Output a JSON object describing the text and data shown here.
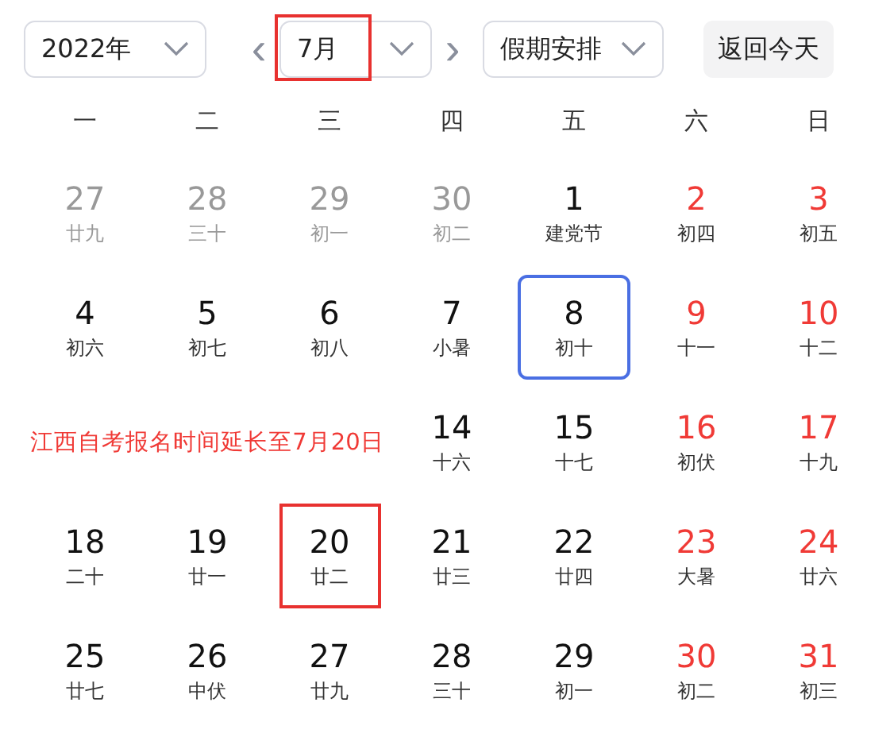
{
  "toolbar": {
    "year": "2022年",
    "month": {
      "value": "7月",
      "highlighted": true
    },
    "holiday": "假期安排",
    "today_button": "返回今天",
    "prev": "‹",
    "next": "›"
  },
  "weekdays": [
    "一",
    "二",
    "三",
    "四",
    "五",
    "六",
    "日"
  ],
  "days": [
    {
      "kind": "other",
      "day": "27",
      "lunar": "廿九"
    },
    {
      "kind": "other",
      "day": "28",
      "lunar": "三十"
    },
    {
      "kind": "other",
      "day": "29",
      "lunar": "初一"
    },
    {
      "kind": "other",
      "day": "30",
      "lunar": "初二"
    },
    {
      "kind": "day",
      "day": "1",
      "lunar": "建党节",
      "red": false,
      "selected": false,
      "highlighted": false
    },
    {
      "kind": "day",
      "day": "2",
      "lunar": "初四",
      "red": true,
      "selected": false,
      "highlighted": false
    },
    {
      "kind": "day",
      "day": "3",
      "lunar": "初五",
      "red": true,
      "selected": false,
      "highlighted": false
    },
    {
      "kind": "day",
      "day": "4",
      "lunar": "初六",
      "red": false,
      "selected": false,
      "highlighted": false
    },
    {
      "kind": "day",
      "day": "5",
      "lunar": "初七",
      "red": false,
      "selected": false,
      "highlighted": false
    },
    {
      "kind": "day",
      "day": "6",
      "lunar": "初八",
      "red": false,
      "selected": false,
      "highlighted": false
    },
    {
      "kind": "day",
      "day": "7",
      "lunar": "小暑",
      "red": false,
      "selected": false,
      "highlighted": false
    },
    {
      "kind": "day",
      "day": "8",
      "lunar": "初十",
      "red": false,
      "selected": true,
      "highlighted": false
    },
    {
      "kind": "day",
      "day": "9",
      "lunar": "十一",
      "red": true,
      "selected": false,
      "highlighted": false
    },
    {
      "kind": "day",
      "day": "10",
      "lunar": "十二",
      "red": true,
      "selected": false,
      "highlighted": false
    },
    {
      "kind": "note",
      "text": "江西自考报名时间延长至7月20日"
    },
    {
      "kind": "day",
      "day": "14",
      "lunar": "十六",
      "red": false,
      "selected": false,
      "highlighted": false
    },
    {
      "kind": "day",
      "day": "15",
      "lunar": "十七",
      "red": false,
      "selected": false,
      "highlighted": false
    },
    {
      "kind": "day",
      "day": "16",
      "lunar": "初伏",
      "red": true,
      "selected": false,
      "highlighted": false
    },
    {
      "kind": "day",
      "day": "17",
      "lunar": "十九",
      "red": true,
      "selected": false,
      "highlighted": false
    },
    {
      "kind": "day",
      "day": "18",
      "lunar": "二十",
      "red": false,
      "selected": false,
      "highlighted": false
    },
    {
      "kind": "day",
      "day": "19",
      "lunar": "廿一",
      "red": false,
      "selected": false,
      "highlighted": false
    },
    {
      "kind": "day",
      "day": "20",
      "lunar": "廿二",
      "red": false,
      "selected": false,
      "highlighted": true
    },
    {
      "kind": "day",
      "day": "21",
      "lunar": "廿三",
      "red": false,
      "selected": false,
      "highlighted": false
    },
    {
      "kind": "day",
      "day": "22",
      "lunar": "廿四",
      "red": false,
      "selected": false,
      "highlighted": false
    },
    {
      "kind": "day",
      "day": "23",
      "lunar": "大暑",
      "red": true,
      "selected": false,
      "highlighted": false
    },
    {
      "kind": "day",
      "day": "24",
      "lunar": "廿六",
      "red": true,
      "selected": false,
      "highlighted": false
    },
    {
      "kind": "day",
      "day": "25",
      "lunar": "廿七",
      "red": false,
      "selected": false,
      "highlighted": false
    },
    {
      "kind": "day",
      "day": "26",
      "lunar": "中伏",
      "red": false,
      "selected": false,
      "highlighted": false
    },
    {
      "kind": "day",
      "day": "27",
      "lunar": "廿九",
      "red": false,
      "selected": false,
      "highlighted": false
    },
    {
      "kind": "day",
      "day": "28",
      "lunar": "三十",
      "red": false,
      "selected": false,
      "highlighted": false
    },
    {
      "kind": "day",
      "day": "29",
      "lunar": "初一",
      "red": false,
      "selected": false,
      "highlighted": false
    },
    {
      "kind": "day",
      "day": "30",
      "lunar": "初二",
      "red": true,
      "selected": false,
      "highlighted": false
    },
    {
      "kind": "day",
      "day": "31",
      "lunar": "初三",
      "red": true,
      "selected": false,
      "highlighted": false
    }
  ]
}
